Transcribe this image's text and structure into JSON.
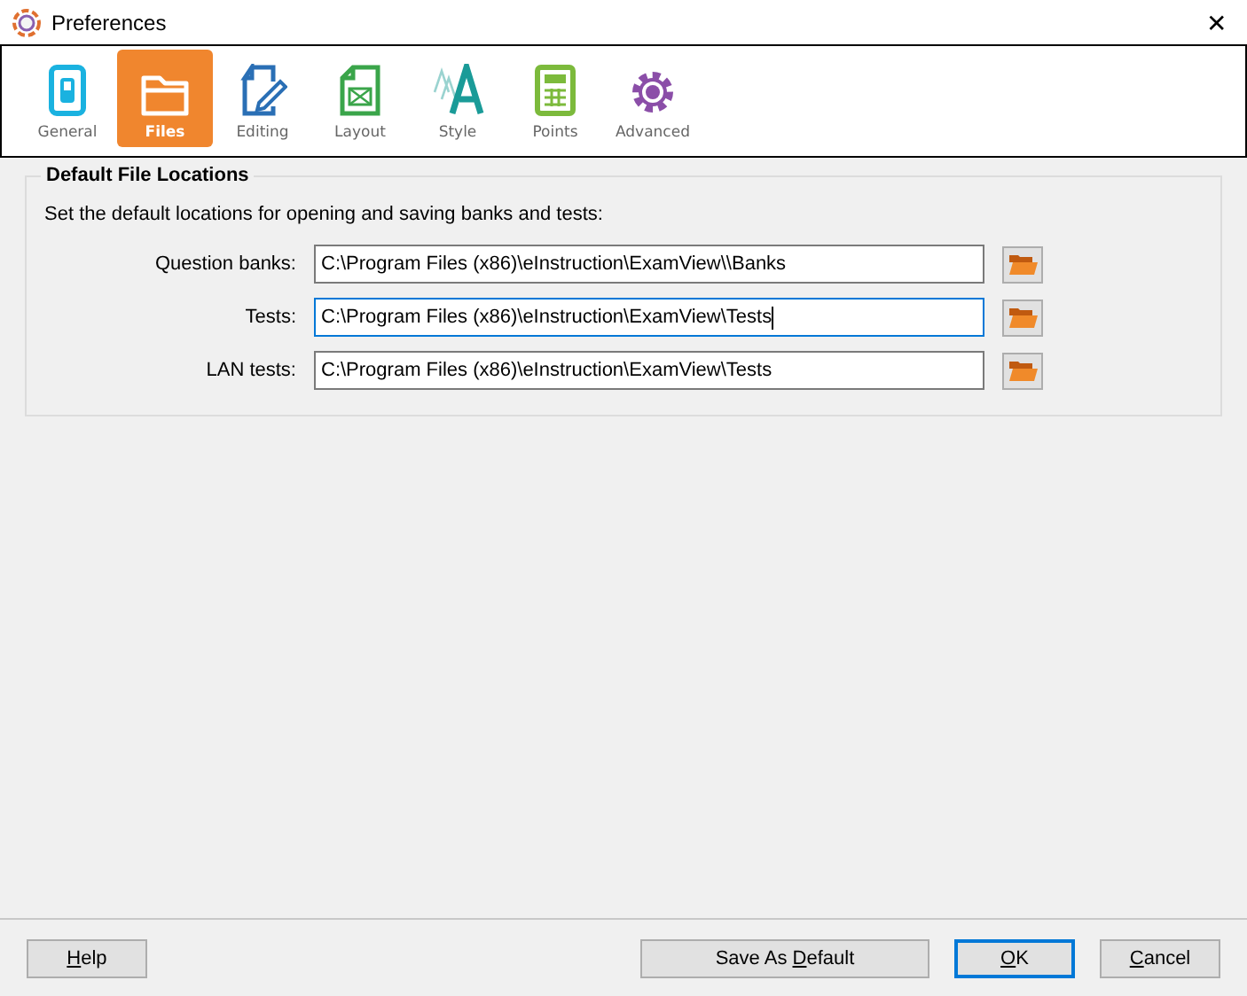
{
  "window": {
    "title": "Preferences",
    "close": "✕"
  },
  "tabs": [
    {
      "kind": "switch",
      "label": "General",
      "selected": false
    },
    {
      "kind": "folder",
      "label": "Files",
      "selected": true
    },
    {
      "kind": "pencil",
      "label": "Editing",
      "selected": false
    },
    {
      "kind": "layout",
      "label": "Layout",
      "selected": false
    },
    {
      "kind": "font",
      "label": "Style",
      "selected": false
    },
    {
      "kind": "calculator",
      "label": "Points",
      "selected": false
    },
    {
      "kind": "gear",
      "label": "Advanced",
      "selected": false
    }
  ],
  "group": {
    "title": "Default File Locations",
    "description": "Set the default locations for opening and saving banks and tests:",
    "fields": [
      {
        "label": "Question banks:",
        "value": "C:\\Program Files (x86)\\eInstruction\\ExamView\\\\Banks",
        "focused": false
      },
      {
        "label": "Tests:",
        "value": "C:\\Program Files (x86)\\eInstruction\\ExamView\\Tests",
        "focused": true
      },
      {
        "label": "LAN tests:",
        "value": "C:\\Program Files (x86)\\eInstruction\\ExamView\\Tests",
        "focused": false
      }
    ]
  },
  "buttons": [
    {
      "key": "H",
      "post": "elp",
      "default": false
    },
    {
      "pre": "Save As ",
      "key": "D",
      "post": "efault",
      "default": false
    },
    {
      "key": "O",
      "post": "K",
      "default": true
    },
    {
      "key": "C",
      "post": "ancel",
      "default": false
    }
  ]
}
